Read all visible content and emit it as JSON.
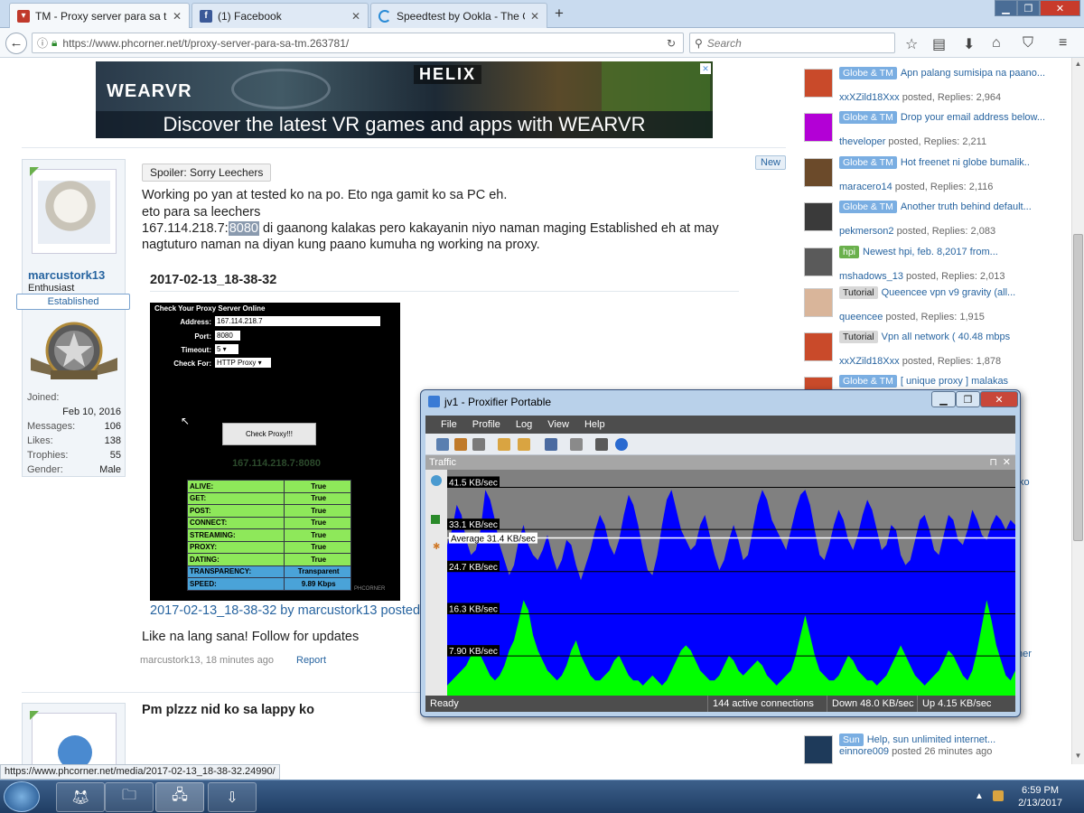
{
  "browser": {
    "tabs": [
      {
        "title": "TM - Proxy server para sa t...",
        "active": true,
        "favicon": "phcorner-icon",
        "color": "#c0392b"
      },
      {
        "title": "(1) Facebook",
        "active": false,
        "favicon": "facebook-icon",
        "color": "#3b5998"
      },
      {
        "title": "Speedtest by Ookla - The G...",
        "active": false,
        "favicon": "loading-icon",
        "color": "#2a8bd6"
      }
    ],
    "new_tab": "+",
    "url": "https://www.phcorner.net/t/proxy-server-para-sa-tm.263781/",
    "url_domain": "phcorner.net",
    "search_placeholder": "Search",
    "status_url": "https://www.phcorner.net/media/2017-02-13_18-38-32.24990/"
  },
  "ad": {
    "logo": "WEARVR",
    "logo2": "HELIX",
    "headline": "Discover the latest VR games and apps with WEARVR"
  },
  "post1": {
    "username": "marcustork13",
    "user_title": "Enthusiast",
    "banner": "Established",
    "stats": [
      {
        "label": "Joined:",
        "value": ""
      },
      {
        "label": "",
        "value": "Feb 10, 2016"
      },
      {
        "label": "Messages:",
        "value": "106"
      },
      {
        "label": "Likes:",
        "value": "138"
      },
      {
        "label": "Trophies:",
        "value": "55"
      },
      {
        "label": "Gender:",
        "value": "Male"
      }
    ],
    "spoiler": "Spoiler: Sorry Leechers",
    "new_badge": "New",
    "line1": "Working po yan at tested ko na po. Eto nga gamit ko sa PC eh.",
    "line2": "eto para sa leechers",
    "line3_prefix": "167.114.218.7:",
    "line3_port": "8080",
    "line3_suffix": " di gaanong kalakas pero kakayanin niyo naman maging Established eh at may",
    "line4": "nagtuturo naman na diyan kung paano kumuha ng working na proxy.",
    "image_title": "2017-02-13_18-38-32",
    "image_caption": "2017-02-13_18-38-32 by marcustork13 posted",
    "closing": "Like na lang sana! Follow for updates",
    "meta_user": "marcustork13",
    "meta_time": ", 18 minutes ago",
    "report": "Report"
  },
  "proxy_image": {
    "header": "Check Your Proxy Server Online",
    "address_label": "Address:",
    "address": "167.114.218.7",
    "port_label": "Port:",
    "port": "8080",
    "timeout_label": "Timeout:",
    "timeout": "5",
    "check_label": "Check For:",
    "check_for": "HTTP Proxy",
    "button": "Check Proxy!!!",
    "result": "167.114.218.7:8080",
    "rows": [
      [
        "ALIVE:",
        "True"
      ],
      [
        "GET:",
        "True"
      ],
      [
        "POST:",
        "True"
      ],
      [
        "CONNECT:",
        "True"
      ],
      [
        "STREAMING:",
        "True"
      ],
      [
        "PROXY:",
        "True"
      ],
      [
        "DATING:",
        "True"
      ],
      [
        "TRANSPARENCY:",
        "Transparent"
      ],
      [
        "SPEED:",
        "9.89 Kbps"
      ]
    ],
    "watermark": "PHCORNER"
  },
  "post2": {
    "title": "Pm plzzz nid ko sa lappy ko"
  },
  "sidebar_threads": [
    {
      "tag": "Globe & TM",
      "tag_style": "blue",
      "title": "Apn palang sumisipa na paano...",
      "user": "xxXZild18Xxx",
      "posted": " posted, Replies: 2,964",
      "avatar_color": "#c94a2a"
    },
    {
      "tag": "Globe & TM",
      "tag_style": "blue",
      "title": "Drop your email address below...",
      "user": "theveloper",
      "posted": " posted, Replies: 2,211",
      "avatar_color": "#b300d6"
    },
    {
      "tag": "Globe & TM",
      "tag_style": "blue",
      "title": "Hot freenet ni globe bumalik..",
      "user": "maracero14",
      "posted": " posted, Replies: 2,116",
      "avatar_color": "#6b4a2a"
    },
    {
      "tag": "Globe & TM",
      "tag_style": "blue",
      "title": "Another truth behind default...",
      "user": "pekmerson2",
      "posted": " posted, Replies: 2,083",
      "avatar_color": "#3a3a3a"
    },
    {
      "tag": "hpi",
      "tag_style": "green",
      "title": "Newest hpi, feb. 8,2017 from...",
      "user": "mshadows_13",
      "posted": " posted, Replies: 2,013",
      "avatar_color": "#5a5a5a"
    },
    {
      "tag": "Tutorial",
      "tag_style": "grey",
      "title": "Queencee vpn v9 gravity (all...",
      "user": "queencee",
      "posted": " posted, Replies: 1,915",
      "avatar_color": "#d9b59a"
    },
    {
      "tag": "Tutorial",
      "tag_style": "grey",
      "title": "Vpn all network ( 40.48 mbps",
      "user": "xxXZild18Xxx",
      "posted": " posted, Replies: 1,878",
      "avatar_color": "#c94a2a"
    },
    {
      "tag": "Globe & TM",
      "tag_style": "blue",
      "title": "[ unique proxy ] malakas",
      "user": "",
      "posted": "",
      "avatar_color": "#c94a2a"
    }
  ],
  "sidebar_bottom": {
    "tag": "Sun",
    "title": "Help, sun unlimited internet...",
    "user": "einnore009",
    "posted": " posted 26 minutes ago",
    "edge_text1": "ko",
    "edge_text2": "her"
  },
  "proxifier": {
    "title": "jv1 - Proxifier Portable",
    "menu": [
      "File",
      "Profile",
      "Log",
      "View",
      "Help"
    ],
    "panel": "Traffic",
    "y_labels": [
      "41.5 KB/sec",
      "33.1 KB/sec",
      "24.7 KB/sec",
      "16.3 KB/sec",
      "7.90 KB/sec"
    ],
    "average": "Average 31.4 KB/sec",
    "status_ready": "Ready",
    "connections": "144 active connections",
    "down": "Down 48.0 KB/sec",
    "up": "Up 4.15 KB/sec",
    "download_color": "#0000ff",
    "upload_color": "#00ff00",
    "download_series": [
      30,
      33,
      38,
      36,
      31,
      28,
      29,
      33,
      41,
      39,
      35,
      30,
      27,
      24,
      26,
      31,
      34,
      30,
      28,
      27,
      29,
      32,
      28,
      25,
      27,
      31,
      30,
      26,
      23,
      26,
      29,
      33,
      36,
      34,
      30,
      28,
      31,
      36,
      40,
      38,
      34,
      29,
      25,
      24,
      28,
      34,
      39,
      41,
      37,
      33,
      31,
      29,
      30,
      34,
      36,
      32,
      28,
      25,
      27,
      31,
      34,
      31,
      27,
      28,
      33,
      38,
      41,
      39,
      35,
      33,
      31,
      29,
      33,
      37,
      40,
      41,
      38,
      33,
      28,
      27,
      30,
      34,
      37,
      35,
      31,
      29,
      32,
      36,
      39,
      37,
      33,
      29,
      30,
      34,
      33,
      28,
      26,
      27,
      31,
      35,
      36,
      33,
      29,
      28,
      32,
      36,
      35,
      31,
      30,
      33,
      37,
      35,
      32,
      31,
      34,
      36,
      35,
      33,
      35,
      34
    ],
    "upload_series": [
      2,
      3,
      4,
      5,
      6,
      8,
      10,
      8,
      6,
      4,
      3,
      4,
      6,
      9,
      11,
      15,
      19,
      17,
      12,
      9,
      7,
      5,
      4,
      3,
      4,
      6,
      9,
      11,
      8,
      6,
      4,
      3,
      3,
      4,
      5,
      7,
      8,
      6,
      4,
      3,
      3,
      2,
      3,
      4,
      3,
      2,
      3,
      5,
      7,
      9,
      10,
      9,
      7,
      5,
      4,
      3,
      3,
      4,
      6,
      8,
      7,
      5,
      4,
      5,
      6,
      7,
      6,
      4,
      3,
      2,
      3,
      4,
      5,
      8,
      12,
      16,
      12,
      8,
      5,
      4,
      3,
      3,
      4,
      6,
      8,
      7,
      5,
      4,
      3,
      3,
      2,
      3,
      4,
      6,
      8,
      10,
      8,
      6,
      4,
      3,
      2,
      3,
      4,
      5,
      7,
      9,
      8,
      6,
      4,
      3,
      5,
      9,
      14,
      19,
      15,
      10,
      7,
      4,
      3,
      5
    ]
  },
  "taskbar": {
    "time": "6:59 PM",
    "date": "2/13/2017"
  }
}
